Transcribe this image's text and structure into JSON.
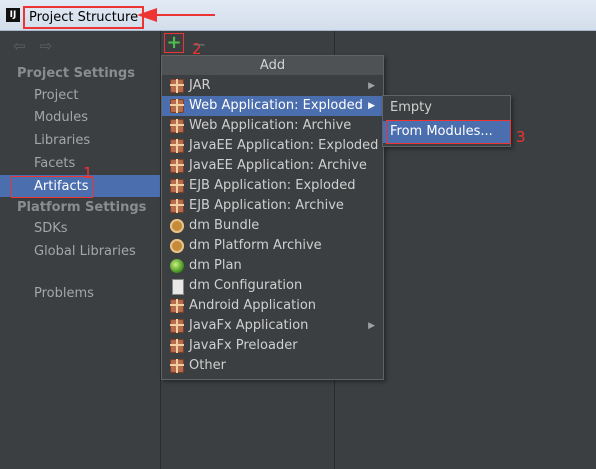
{
  "window": {
    "title": "Project Structure",
    "app_icon": "IJ"
  },
  "toolbar": {
    "add_icon": "+",
    "remove_icon": "−"
  },
  "sidebar": {
    "back_icon": "⇦",
    "forward_icon": "⇨",
    "project_settings_header": "Project Settings",
    "project_settings_items": [
      "Project",
      "Modules",
      "Libraries",
      "Facets",
      "Artifacts"
    ],
    "platform_settings_header": "Platform Settings",
    "platform_settings_items": [
      "SDKs",
      "Global Libraries"
    ],
    "other_items": [
      "Problems"
    ],
    "selected": "Artifacts"
  },
  "annotations": {
    "step1": "1",
    "step2": "2",
    "step3": "3",
    "color": "#ee3333"
  },
  "add_menu": {
    "title": "Add",
    "items": [
      {
        "label": "JAR",
        "icon": "gift-icon",
        "submenu": true
      },
      {
        "label": "Web Application: Exploded",
        "icon": "gift-icon",
        "submenu": true,
        "selected": true
      },
      {
        "label": "Web Application: Archive",
        "icon": "gift-icon"
      },
      {
        "label": "JavaEE Application: Exploded",
        "icon": "gift-icon"
      },
      {
        "label": "JavaEE Application: Archive",
        "icon": "gift-icon"
      },
      {
        "label": "EJB Application: Exploded",
        "icon": "gift-icon"
      },
      {
        "label": "EJB Application: Archive",
        "icon": "gift-icon"
      },
      {
        "label": "dm Bundle",
        "icon": "plugin-icon"
      },
      {
        "label": "dm Platform Archive",
        "icon": "plugin-icon"
      },
      {
        "label": "dm Plan",
        "icon": "globe-icon"
      },
      {
        "label": "dm Configuration",
        "icon": "document-icon"
      },
      {
        "label": "Android Application",
        "icon": "gift-icon"
      },
      {
        "label": "JavaFx Application",
        "icon": "gift-icon",
        "submenu": true
      },
      {
        "label": "JavaFx Preloader",
        "icon": "gift-icon"
      },
      {
        "label": "Other",
        "icon": "gift-icon"
      }
    ]
  },
  "submenu": {
    "items": [
      {
        "label": "Empty"
      },
      {
        "label": "From Modules...",
        "selected": true
      }
    ]
  },
  "colors": {
    "selection": "#4b6eaf",
    "background": "#3c3f41",
    "add_icon": "#48c04b"
  }
}
